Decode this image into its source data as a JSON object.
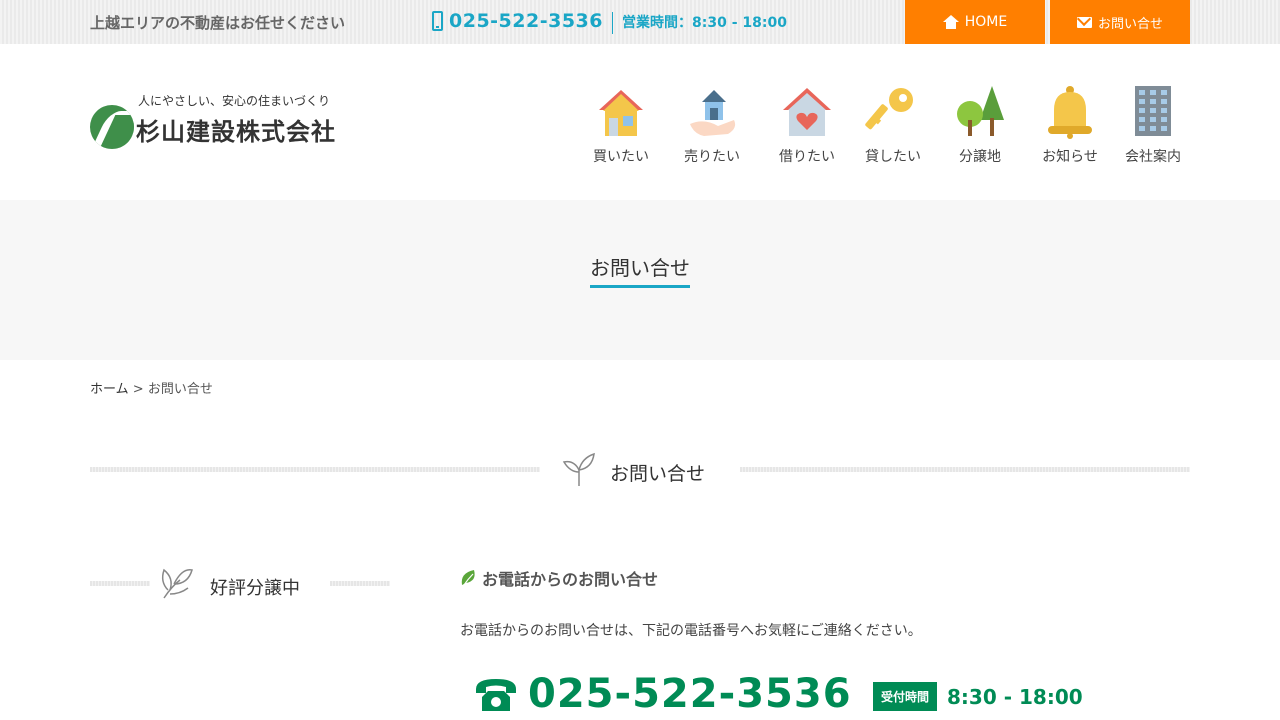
{
  "topbar": {
    "tagline": "上越エリアの不動産はお任せください",
    "phone": "025-522-3536",
    "hours": "営業時間：8:30 - 18:00",
    "home_button": "HOME",
    "contact_button": "お問い合せ"
  },
  "header": {
    "slogan": "人にやさしい、安心の住まいづくり",
    "company": "杉山建設株式会社",
    "nav": [
      {
        "label": "買いたい",
        "icon": "house-buy-icon"
      },
      {
        "label": "売りたい",
        "icon": "house-sell-icon"
      },
      {
        "label": "借りたい",
        "icon": "house-heart-icon"
      },
      {
        "label": "貸したい",
        "icon": "key-icon"
      },
      {
        "label": "分譲地",
        "icon": "trees-icon"
      },
      {
        "label": "お知らせ",
        "icon": "bell-icon"
      },
      {
        "label": "会社案内",
        "icon": "building-icon"
      }
    ]
  },
  "page": {
    "title": "お問い合せ",
    "breadcrumb": {
      "home": "ホーム",
      "separator": ">",
      "current": "お問い合せ"
    },
    "section_heading": "お問い合せ"
  },
  "sidebar": {
    "heading": "好評分譲中"
  },
  "main": {
    "subheading": "お電話からのお問い合せ",
    "intro": "お電話からのお問い合せは、下記の電話番号へお気軽にご連絡ください。",
    "phone": "025-522-3536",
    "reception_label": "受付時間",
    "reception_hours": "8:30 - 18:00"
  },
  "colors": {
    "accent_orange": "#ff7f00",
    "accent_cyan": "#1aa6c6",
    "accent_green": "#008b55"
  }
}
